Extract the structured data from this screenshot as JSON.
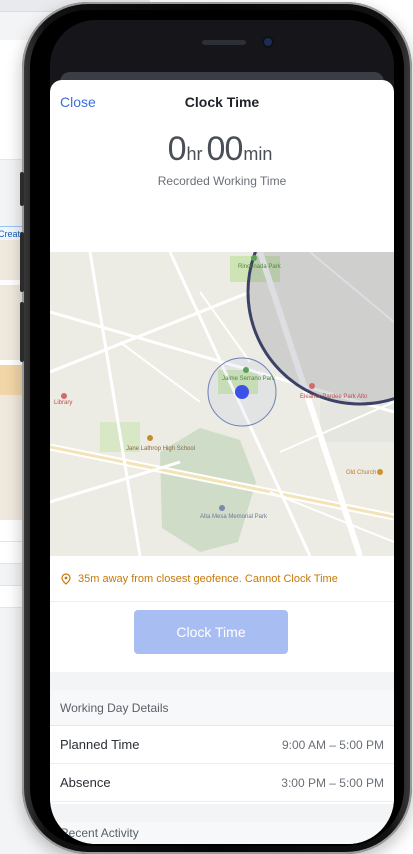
{
  "background_app": {
    "cta_label": "Create n"
  },
  "sheet": {
    "close_label": "Close",
    "title": "Clock Time"
  },
  "timer": {
    "hours": "0",
    "hours_unit": "hr",
    "minutes": "00",
    "minutes_unit": "min",
    "label": "Recorded Working Time"
  },
  "map": {
    "labels": {
      "park_top": "Rinconada Park",
      "park_center": "Jaime Serrano Park",
      "library": "Library",
      "school": "Jane Lathrop High School",
      "church": "Old Church",
      "medical": "Alta Mesa Memorial Park",
      "clinic": "Eleanor Pardee Park Alto"
    },
    "colors": {
      "geofence": "#3b4266",
      "user_dot": "#3c52e6",
      "park": "#cfe4b5"
    }
  },
  "alert": {
    "text": "35m away from closest geofence. Cannot Clock Time",
    "icon": "location-pin-icon",
    "color": "#c6790b"
  },
  "cta": {
    "label": "Clock Time",
    "color": "#a8bdf2"
  },
  "working_day": {
    "title": "Working Day Details",
    "rows": [
      {
        "label": "Planned Time",
        "value": "9:00 AM – 5:00 PM"
      },
      {
        "label": "Absence",
        "value": "3:00 PM – 5:00 PM"
      }
    ]
  },
  "recent": {
    "title": "Recent Activity"
  }
}
